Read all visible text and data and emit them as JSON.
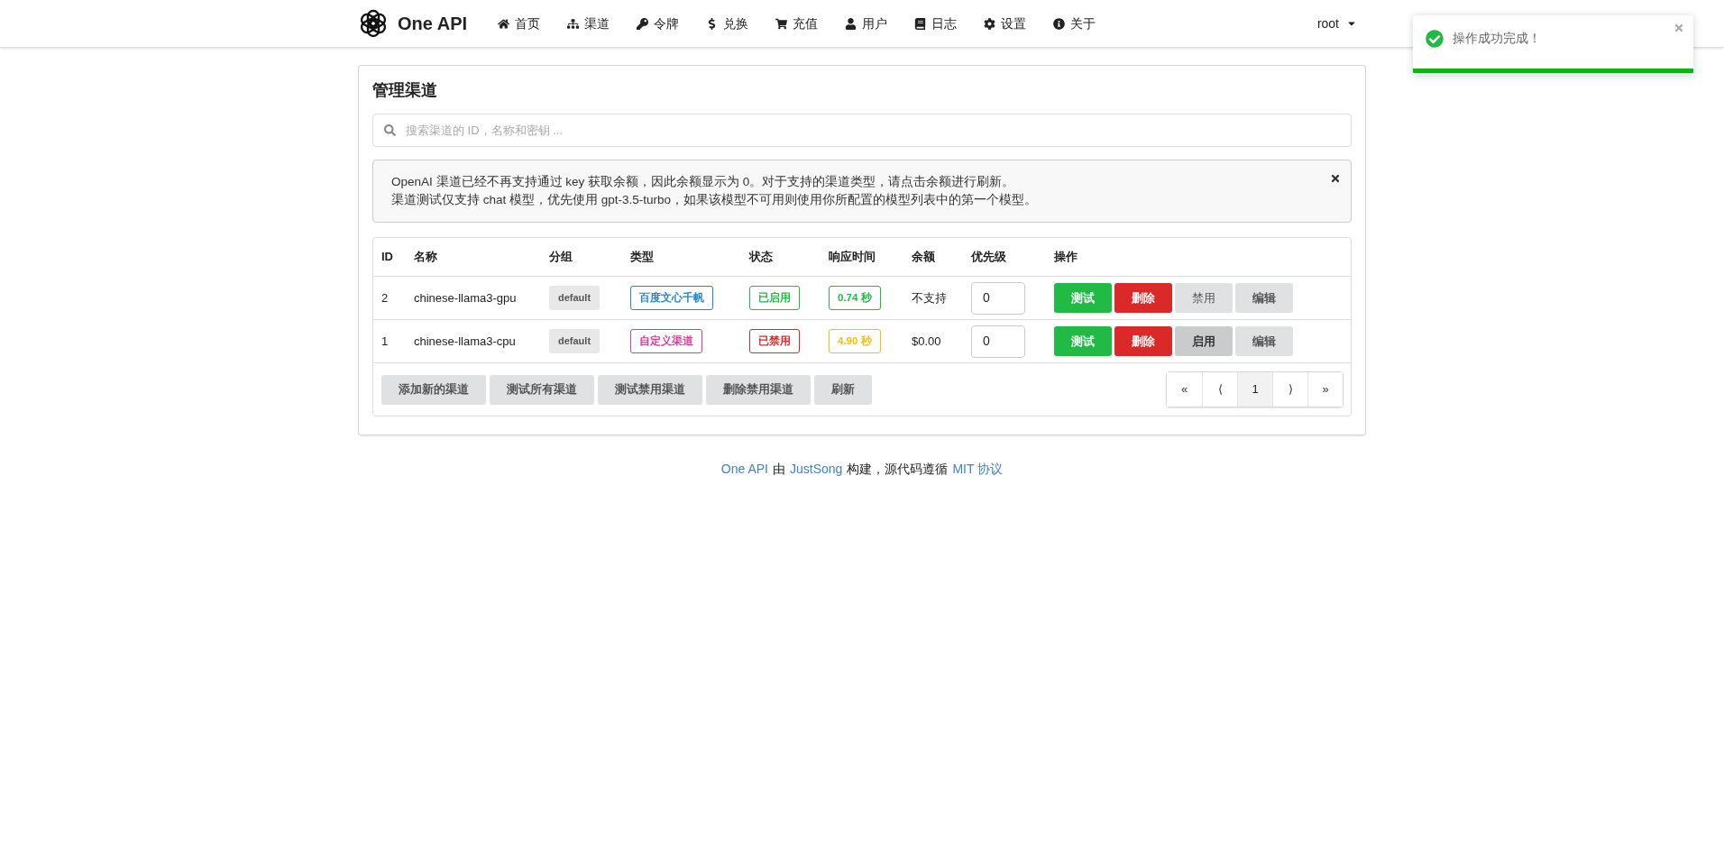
{
  "navbar": {
    "brand": "One API",
    "items": [
      {
        "label": "首页"
      },
      {
        "label": "渠道"
      },
      {
        "label": "令牌"
      },
      {
        "label": "兑换"
      },
      {
        "label": "充值"
      },
      {
        "label": "用户"
      },
      {
        "label": "日志"
      },
      {
        "label": "设置"
      },
      {
        "label": "关于"
      }
    ],
    "user": "root"
  },
  "toast": {
    "message": "操作成功完成！",
    "level": 1
  },
  "card": {
    "title": "管理渠道",
    "search": {
      "placeholder": "搜索渠道的 ID，名称和密钥 ..."
    },
    "message": [
      "OpenAI 渠道已经不再支持通过 key 获取余额，因此余额显示为 0。对于支持的渠道类型，请点击余额进行刷新。",
      "渠道测试仅支持 chat 模型，优先使用 gpt-3.5-turbo，如果该模型不可用则使用你所配置的模型列表中的第一个模型。"
    ],
    "table": {
      "columns": [
        "ID",
        "名称",
        "分组",
        "类型",
        "状态",
        "响应时间",
        "余额",
        "优先级",
        "操作"
      ],
      "rows": [
        {
          "id": "2",
          "name": "chinese-llama3-gpu",
          "group": "default",
          "type": {
            "label": "百度文心千帆",
            "color": "#2185d0"
          },
          "status": {
            "label": "已启用",
            "color": "#21ba45"
          },
          "response": {
            "label": "0.74 秒",
            "color": "#21ba45"
          },
          "balance": "不支持",
          "priority": "0",
          "actions": [
            {
              "kind": "test",
              "label": "测试",
              "hovered": false
            },
            {
              "kind": "delete",
              "label": "删除",
              "hovered": false
            },
            {
              "kind": "toggle",
              "label": "禁用",
              "hovered": false
            },
            {
              "kind": "edit",
              "label": "编辑",
              "hovered": false
            }
          ]
        },
        {
          "id": "1",
          "name": "chinese-llama3-cpu",
          "group": "default",
          "type": {
            "label": "自定义渠道",
            "color": "#e03997"
          },
          "status": {
            "label": "已禁用",
            "color": "#db2828"
          },
          "response": {
            "label": "4.90 秒",
            "color": "#fbbd08"
          },
          "balance": "$0.00",
          "priority": "0",
          "actions": [
            {
              "kind": "test",
              "label": "测试",
              "hovered": false
            },
            {
              "kind": "delete",
              "label": "删除",
              "hovered": false
            },
            {
              "kind": "toggle",
              "label": "启用",
              "hovered": true
            },
            {
              "kind": "edit",
              "label": "编辑",
              "hovered": false
            }
          ]
        }
      ]
    },
    "footer_buttons": [
      "添加新的渠道",
      "测试所有渠道",
      "测试禁用渠道",
      "删除禁用渠道",
      "刷新"
    ],
    "pagination": [
      {
        "label": "«",
        "selected": false
      },
      {
        "label": "⟨",
        "selected": false
      },
      {
        "label": "1",
        "selected": true
      },
      {
        "label": "⟩",
        "selected": false
      },
      {
        "label": "»",
        "selected": false
      }
    ]
  },
  "footer": [
    {
      "kind": "link",
      "text": "One API"
    },
    {
      "kind": "text",
      "text": "由"
    },
    {
      "kind": "link",
      "text": "JustSong"
    },
    {
      "kind": "text",
      "text": "构建，源代码遵循"
    },
    {
      "kind": "link",
      "text": "MIT 协议"
    }
  ]
}
